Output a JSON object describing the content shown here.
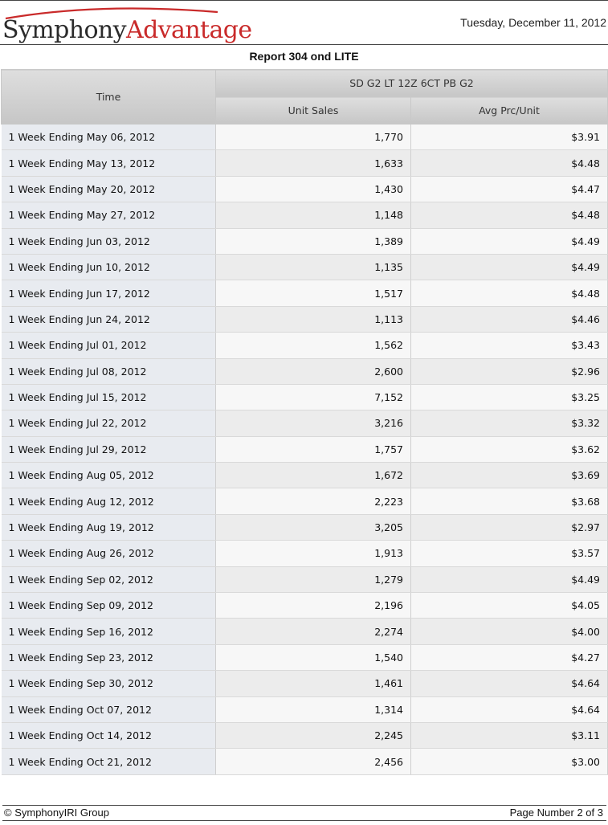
{
  "header": {
    "logo_part1": "Symphony",
    "logo_part2": "Advantage",
    "date": "Tuesday, December 11, 2012"
  },
  "report_title": "Report 304 ond LITE",
  "table": {
    "time_header": "Time",
    "product_header": "SD G2 LT 12Z 6CT PB G2",
    "col_unit_sales": "Unit Sales",
    "col_avg_price": "Avg Prc/Unit",
    "rows": [
      {
        "time": "1 Week Ending May 06, 2012",
        "units": "1,770",
        "price": "$3.91"
      },
      {
        "time": "1 Week Ending May 13, 2012",
        "units": "1,633",
        "price": "$4.48"
      },
      {
        "time": "1 Week Ending May 20, 2012",
        "units": "1,430",
        "price": "$4.47"
      },
      {
        "time": "1 Week Ending May 27, 2012",
        "units": "1,148",
        "price": "$4.48"
      },
      {
        "time": "1 Week Ending Jun 03, 2012",
        "units": "1,389",
        "price": "$4.49"
      },
      {
        "time": "1 Week Ending Jun 10, 2012",
        "units": "1,135",
        "price": "$4.49"
      },
      {
        "time": "1 Week Ending Jun 17, 2012",
        "units": "1,517",
        "price": "$4.48"
      },
      {
        "time": "1 Week Ending Jun 24, 2012",
        "units": "1,113",
        "price": "$4.46"
      },
      {
        "time": "1 Week Ending Jul 01, 2012",
        "units": "1,562",
        "price": "$3.43"
      },
      {
        "time": "1 Week Ending Jul 08, 2012",
        "units": "2,600",
        "price": "$2.96"
      },
      {
        "time": "1 Week Ending Jul 15, 2012",
        "units": "7,152",
        "price": "$3.25"
      },
      {
        "time": "1 Week Ending Jul 22, 2012",
        "units": "3,216",
        "price": "$3.32"
      },
      {
        "time": "1 Week Ending Jul 29, 2012",
        "units": "1,757",
        "price": "$3.62"
      },
      {
        "time": "1 Week Ending Aug 05, 2012",
        "units": "1,672",
        "price": "$3.69"
      },
      {
        "time": "1 Week Ending Aug 12, 2012",
        "units": "2,223",
        "price": "$3.68"
      },
      {
        "time": "1 Week Ending Aug 19, 2012",
        "units": "3,205",
        "price": "$2.97"
      },
      {
        "time": "1 Week Ending Aug 26, 2012",
        "units": "1,913",
        "price": "$3.57"
      },
      {
        "time": "1 Week Ending Sep 02, 2012",
        "units": "1,279",
        "price": "$4.49"
      },
      {
        "time": "1 Week Ending Sep 09, 2012",
        "units": "2,196",
        "price": "$4.05"
      },
      {
        "time": "1 Week Ending Sep 16, 2012",
        "units": "2,274",
        "price": "$4.00"
      },
      {
        "time": "1 Week Ending Sep 23, 2012",
        "units": "1,540",
        "price": "$4.27"
      },
      {
        "time": "1 Week Ending Sep 30, 2012",
        "units": "1,461",
        "price": "$4.64"
      },
      {
        "time": "1 Week Ending Oct 07, 2012",
        "units": "1,314",
        "price": "$4.64"
      },
      {
        "time": "1 Week Ending Oct 14, 2012",
        "units": "2,245",
        "price": "$3.11"
      },
      {
        "time": "1 Week Ending Oct 21, 2012",
        "units": "2,456",
        "price": "$3.00"
      }
    ]
  },
  "footer": {
    "copyright": "© SymphonyIRI Group",
    "page": "Page Number 2 of 3"
  }
}
